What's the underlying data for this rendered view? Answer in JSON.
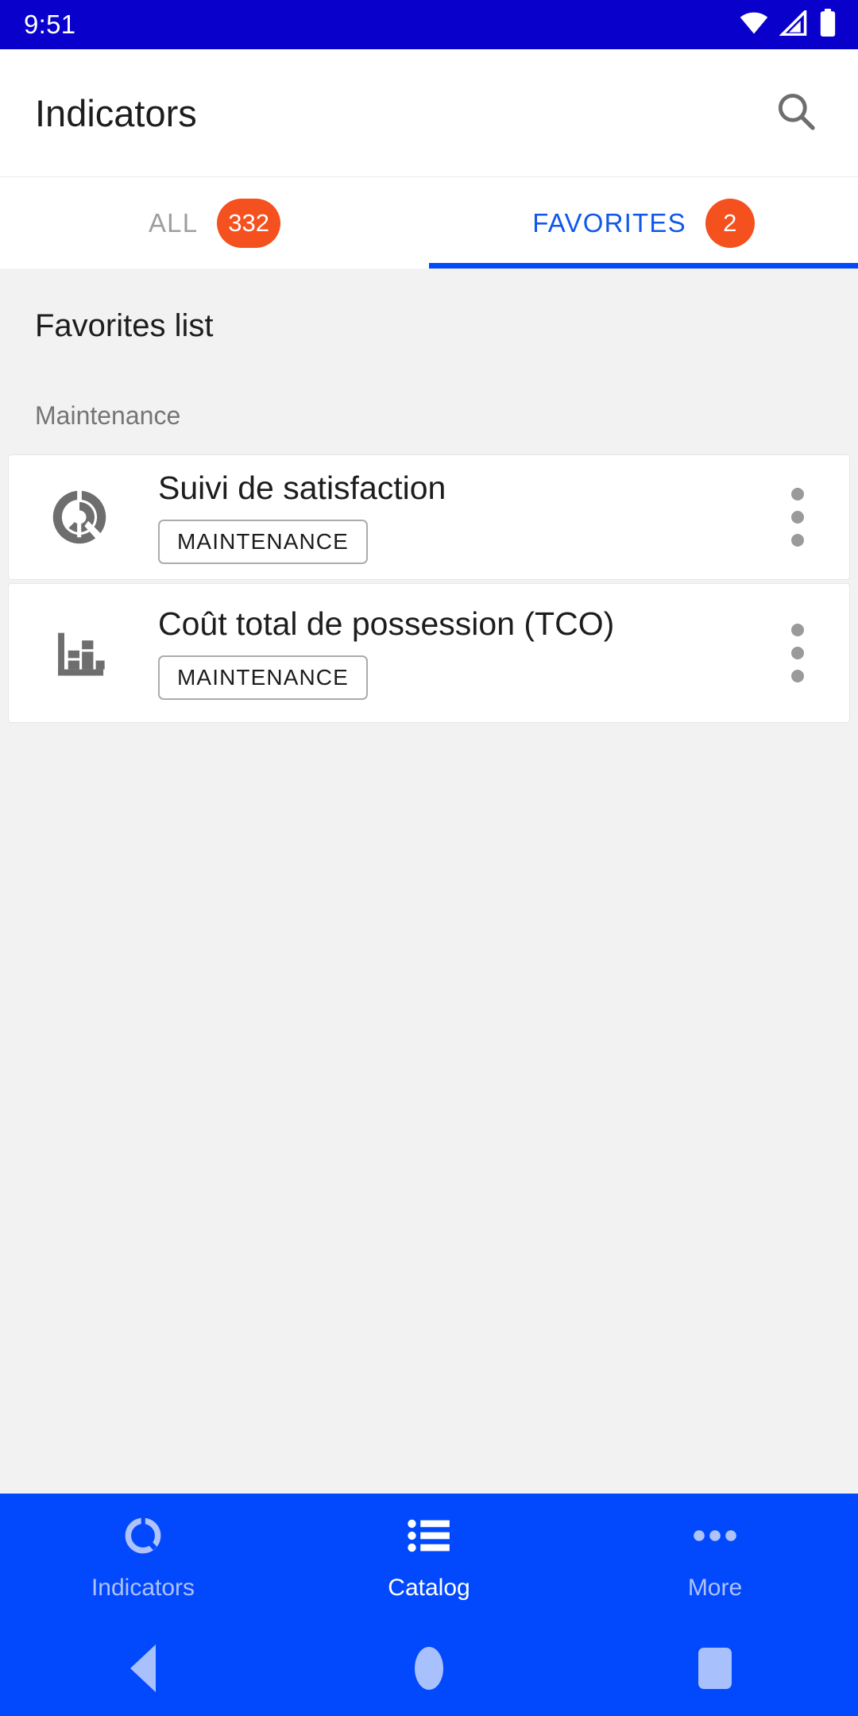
{
  "status_bar": {
    "time": "9:51",
    "icons": [
      "wifi-icon",
      "cellular-signal-icon",
      "battery-icon"
    ],
    "background": "#0A00CC"
  },
  "app_bar": {
    "title": "Indicators",
    "search_icon": "search-icon"
  },
  "tabs": [
    {
      "label": "ALL",
      "badge": "332",
      "selected": false
    },
    {
      "label": "FAVORITES",
      "badge": "2",
      "selected": true
    }
  ],
  "tab_colors": {
    "selected_text": "#1158E8",
    "unselected_text": "#9E9E9E",
    "indicator": "#0249FD",
    "badge_background": "#F4511E",
    "badge_text": "#FFFFFF"
  },
  "content": {
    "list_title": "Favorites list",
    "group_label": "Maintenance",
    "items": [
      {
        "icon": "donut-chart-icon",
        "title": "Suivi de satisfaction",
        "chip": "MAINTENANCE",
        "overflow": "kebab-menu-icon"
      },
      {
        "icon": "bar-chart-icon",
        "title": "Coût total de possession (TCO)",
        "chip": "MAINTENANCE",
        "overflow": "kebab-menu-icon"
      }
    ]
  },
  "bottom_nav": {
    "background": "#0249FD",
    "items": [
      {
        "label": "Indicators",
        "icon": "donut-chart-icon",
        "active": false
      },
      {
        "label": "Catalog",
        "icon": "list-icon",
        "active": true
      },
      {
        "label": "More",
        "icon": "more-horizontal-icon",
        "active": false
      }
    ]
  },
  "system_nav": {
    "buttons": [
      "back-button",
      "home-button",
      "recents-button"
    ],
    "tint": "#A8C0FC"
  }
}
